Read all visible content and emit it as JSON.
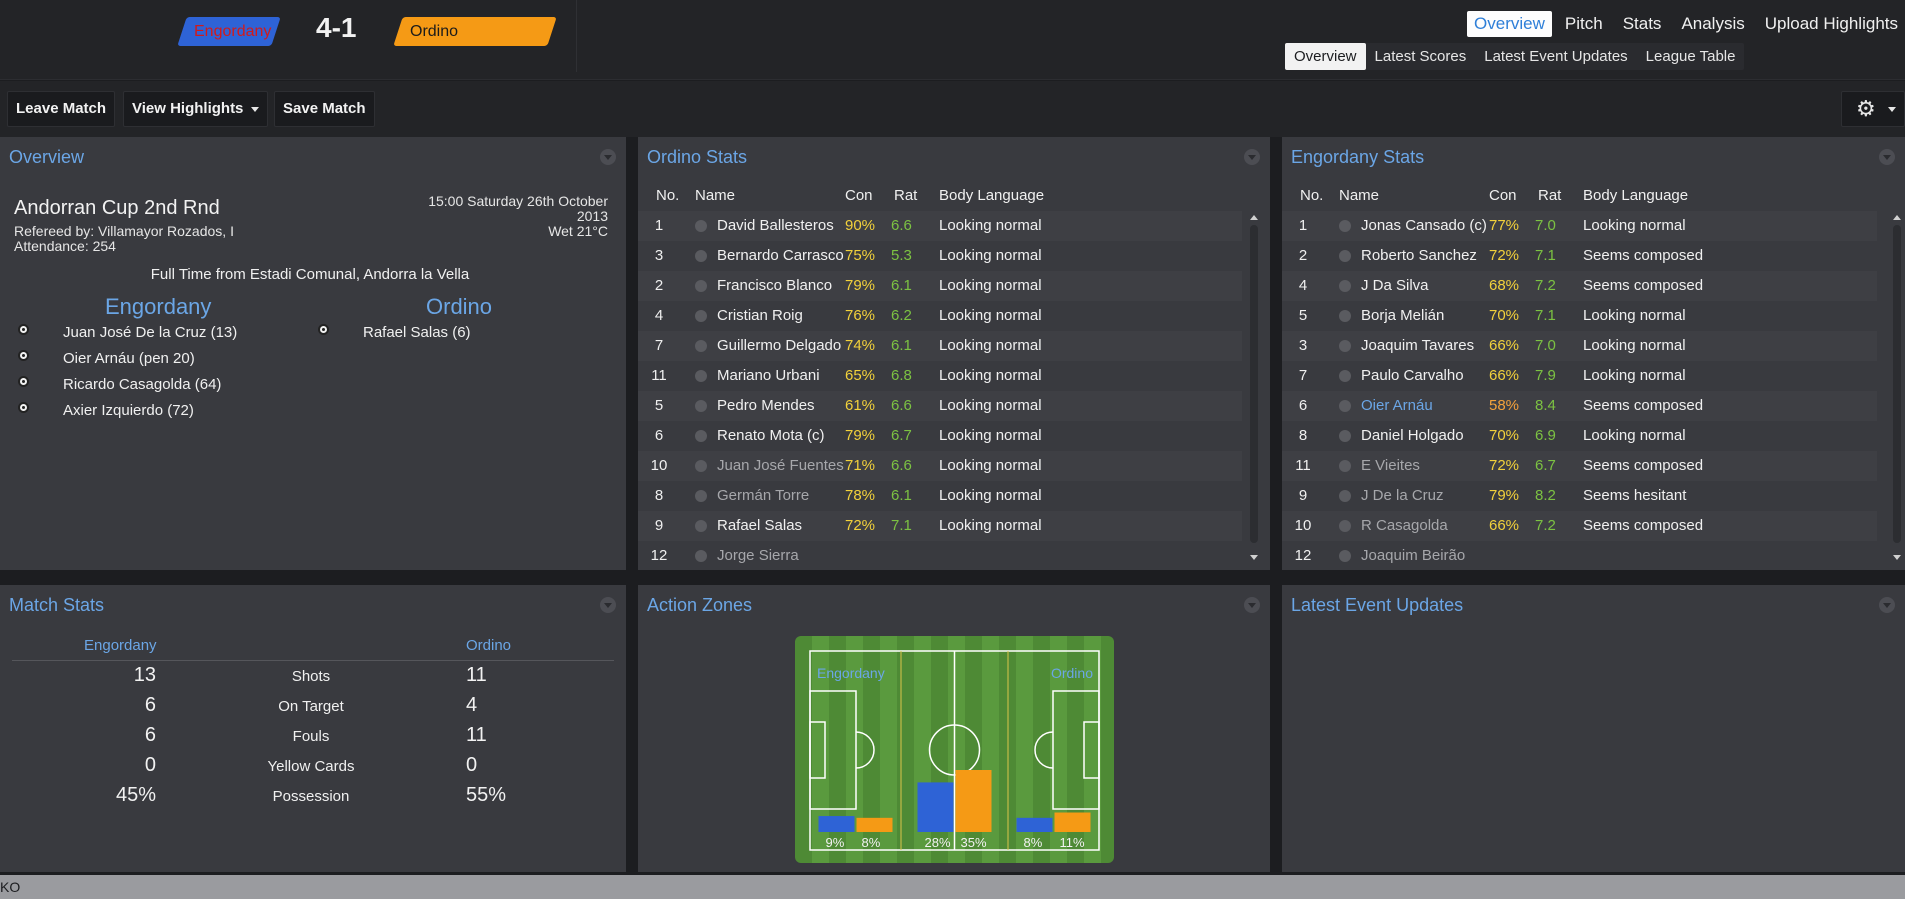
{
  "header": {
    "home_team": "Engordany",
    "away_team": "Ordino",
    "score": "4-1",
    "home_color": "#2e63d6",
    "home_text_color": "#d11b1b",
    "away_color": "#f59a15"
  },
  "nav": {
    "top": [
      "Overview",
      "Pitch",
      "Stats",
      "Analysis",
      "Upload Highlights"
    ],
    "top_active": "Overview",
    "sub": [
      "Overview",
      "Latest Scores",
      "Latest Event Updates",
      "League Table"
    ],
    "sub_active": "Overview"
  },
  "toolbar": {
    "leave": "Leave Match",
    "highlights": "View Highlights",
    "save": "Save Match",
    "settings_icon": "gear-icon"
  },
  "overview": {
    "title": "Overview",
    "competition": "Andorran Cup 2nd Rnd",
    "referee": "Refereed by: Villamayor Rozados, I",
    "attendance": "Attendance: 254",
    "datetime": "15:00 Saturday 26th October 2013",
    "weather": "Wet 21°C",
    "result_line": "Full Time from Estadi Comunal, Andorra la Vella",
    "home_name": "Engordany",
    "away_name": "Ordino",
    "home_scorers": [
      "Juan José De la Cruz (13)",
      "Oier Arnáu (pen 20)",
      "Ricardo Casagolda (64)",
      "Axier Izquierdo (72)"
    ],
    "away_scorers": [
      "Rafael Salas (6)"
    ]
  },
  "ordino_stats": {
    "title": "Ordino Stats",
    "columns": [
      "No.",
      "Name",
      "Con",
      "Rat",
      "Body Language"
    ],
    "rows": [
      {
        "no": "1",
        "name": "David Ballesteros",
        "con": "90%",
        "rat": "6.6",
        "body": "Looking normal",
        "style": ""
      },
      {
        "no": "3",
        "name": "Bernardo Carrasco",
        "con": "75%",
        "rat": "5.3",
        "body": "Looking normal",
        "style": ""
      },
      {
        "no": "2",
        "name": "Francisco Blanco",
        "con": "79%",
        "rat": "6.1",
        "body": "Looking normal",
        "style": ""
      },
      {
        "no": "4",
        "name": "Cristian Roig",
        "con": "76%",
        "rat": "6.2",
        "body": "Looking normal",
        "style": ""
      },
      {
        "no": "7",
        "name": "Guillermo Delgado",
        "con": "74%",
        "rat": "6.1",
        "body": "Looking normal",
        "style": ""
      },
      {
        "no": "11",
        "name": "Mariano Urbani",
        "con": "65%",
        "rat": "6.8",
        "body": "Looking normal",
        "style": ""
      },
      {
        "no": "5",
        "name": "Pedro Mendes",
        "con": "61%",
        "rat": "6.6",
        "body": "Looking normal",
        "style": ""
      },
      {
        "no": "6",
        "name": "Renato Mota (c)",
        "con": "79%",
        "rat": "6.7",
        "body": "Looking normal",
        "style": ""
      },
      {
        "no": "10",
        "name": "Juan José Fuentes",
        "con": "71%",
        "rat": "6.6",
        "body": "Looking normal",
        "style": "dim"
      },
      {
        "no": "8",
        "name": "Germán Torre",
        "con": "78%",
        "rat": "6.1",
        "body": "Looking normal",
        "style": "dim"
      },
      {
        "no": "9",
        "name": "Rafael Salas",
        "con": "72%",
        "rat": "7.1",
        "body": "Looking normal",
        "style": ""
      },
      {
        "no": "12",
        "name": "Jorge Sierra",
        "con": "",
        "rat": "",
        "body": "",
        "style": "dim"
      }
    ]
  },
  "engordany_stats": {
    "title": "Engordany Stats",
    "columns": [
      "No.",
      "Name",
      "Con",
      "Rat",
      "Body Language"
    ],
    "rows": [
      {
        "no": "1",
        "name": "Jonas Cansado (c)",
        "con": "77%",
        "rat": "7.0",
        "body": "Looking normal",
        "style": ""
      },
      {
        "no": "2",
        "name": "Roberto Sanchez",
        "con": "72%",
        "rat": "7.1",
        "body": "Seems composed",
        "style": ""
      },
      {
        "no": "4",
        "name": "J Da Silva",
        "con": "68%",
        "rat": "7.2",
        "body": "Seems composed",
        "style": ""
      },
      {
        "no": "5",
        "name": "Borja Melián",
        "con": "70%",
        "rat": "7.1",
        "body": "Looking normal",
        "style": ""
      },
      {
        "no": "3",
        "name": "Joaquim Tavares",
        "con": "66%",
        "rat": "7.0",
        "body": "Looking normal",
        "style": ""
      },
      {
        "no": "7",
        "name": "Paulo Carvalho",
        "con": "66%",
        "rat": "7.9",
        "body": "Looking normal",
        "style": ""
      },
      {
        "no": "6",
        "name": "Oier Arnáu",
        "con": "58%",
        "rat": "8.4",
        "body": "Seems composed",
        "style": "blue"
      },
      {
        "no": "8",
        "name": "Daniel Holgado",
        "con": "70%",
        "rat": "6.9",
        "body": "Looking normal",
        "style": ""
      },
      {
        "no": "11",
        "name": "E Vieites",
        "con": "72%",
        "rat": "6.7",
        "body": "Seems composed",
        "style": "dim"
      },
      {
        "no": "9",
        "name": "J De la Cruz",
        "con": "79%",
        "rat": "8.2",
        "body": "Seems hesitant",
        "style": "dim"
      },
      {
        "no": "10",
        "name": "R Casagolda",
        "con": "66%",
        "rat": "7.2",
        "body": "Seems composed",
        "style": "dim"
      },
      {
        "no": "12",
        "name": "Joaquim Beirão",
        "con": "",
        "rat": "",
        "body": "",
        "style": "dim"
      }
    ]
  },
  "match_stats": {
    "title": "Match Stats",
    "home": "Engordany",
    "away": "Ordino",
    "rows": [
      {
        "label": "Shots",
        "home": "13",
        "away": "11"
      },
      {
        "label": "On Target",
        "home": "6",
        "away": "4"
      },
      {
        "label": "Fouls",
        "home": "6",
        "away": "11"
      },
      {
        "label": "Yellow Cards",
        "home": "0",
        "away": "0"
      },
      {
        "label": "Possession",
        "home": "45%",
        "away": "55%"
      }
    ]
  },
  "action_zones": {
    "title": "Action Zones",
    "home": "Engordany",
    "away": "Ordino",
    "zones": [
      {
        "home": 9,
        "away": 8,
        "home_label": "9%",
        "away_label": "8%"
      },
      {
        "home": 28,
        "away": 35,
        "home_label": "28%",
        "away_label": "35%"
      },
      {
        "home": 8,
        "away": 11,
        "home_label": "8%",
        "away_label": "11%"
      }
    ]
  },
  "events": {
    "title": "Latest Event Updates"
  },
  "status": {
    "text": "KO"
  }
}
